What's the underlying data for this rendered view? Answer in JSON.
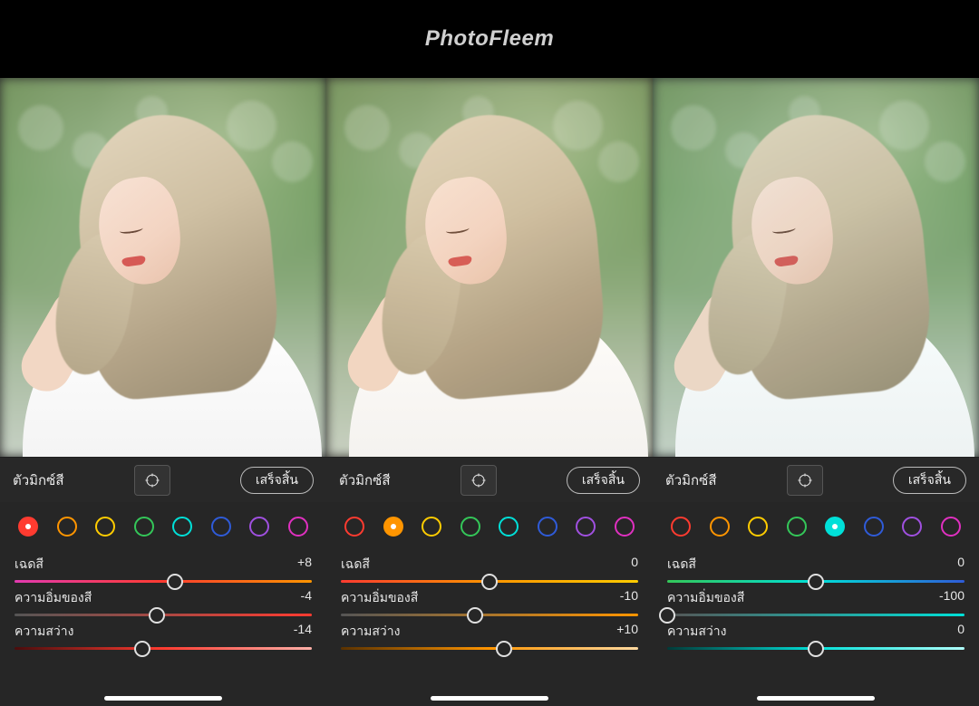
{
  "header": {
    "title": "PhotoFleem"
  },
  "swatch_colors": [
    {
      "name": "red",
      "hex": "#ff3b30"
    },
    {
      "name": "orange",
      "hex": "#ff9500"
    },
    {
      "name": "yellow",
      "hex": "#ffcc00"
    },
    {
      "name": "green",
      "hex": "#34c759"
    },
    {
      "name": "aqua",
      "hex": "#00e0d8"
    },
    {
      "name": "blue",
      "hex": "#2f5bd8"
    },
    {
      "name": "purple",
      "hex": "#a050e0"
    },
    {
      "name": "magenta",
      "hex": "#e030c0"
    }
  ],
  "panels": [
    {
      "toolbar": {
        "title": "ตัวมิกซ์สี",
        "done": "เสร็จสิ้น"
      },
      "selected_swatch": 0,
      "sliders": [
        {
          "label": "เฉดสี",
          "value": "+8",
          "pos": 54,
          "gradient": "linear-gradient(90deg,#e23ab0,#ff3b30,#ff9500)"
        },
        {
          "label": "ความอิ่มของสี",
          "value": "-4",
          "pos": 48,
          "gradient": "linear-gradient(90deg,#555555,#ff3b30)"
        },
        {
          "label": "ความสว่าง",
          "value": "-14",
          "pos": 43,
          "gradient": "linear-gradient(90deg,#4a0c0c,#ff3b30,#ffb0a8)"
        }
      ]
    },
    {
      "toolbar": {
        "title": "ตัวมิกซ์สี",
        "done": "เสร็จสิ้น"
      },
      "selected_swatch": 1,
      "sliders": [
        {
          "label": "เฉดสี",
          "value": "0",
          "pos": 50,
          "gradient": "linear-gradient(90deg,#ff3b30,#ff9500,#ffcc00)"
        },
        {
          "label": "ความอิ่มของสี",
          "value": "-10",
          "pos": 45,
          "gradient": "linear-gradient(90deg,#555555,#ff9500)"
        },
        {
          "label": "ความสว่าง",
          "value": "+10",
          "pos": 55,
          "gradient": "linear-gradient(90deg,#5a3200,#ff9500,#ffd9a0)"
        }
      ]
    },
    {
      "toolbar": {
        "title": "ตัวมิกซ์สี",
        "done": "เสร็จสิ้น"
      },
      "selected_swatch": 4,
      "sliders": [
        {
          "label": "เฉดสี",
          "value": "0",
          "pos": 50,
          "gradient": "linear-gradient(90deg,#34c759,#00e0d8,#2f5bd8)"
        },
        {
          "label": "ความอิ่มของสี",
          "value": "-100",
          "pos": 0,
          "gradient": "linear-gradient(90deg,#555555,#00e0d8)"
        },
        {
          "label": "ความสว่าง",
          "value": "0",
          "pos": 50,
          "gradient": "linear-gradient(90deg,#003a38,#00e0d8,#b0fffb)"
        }
      ]
    }
  ]
}
